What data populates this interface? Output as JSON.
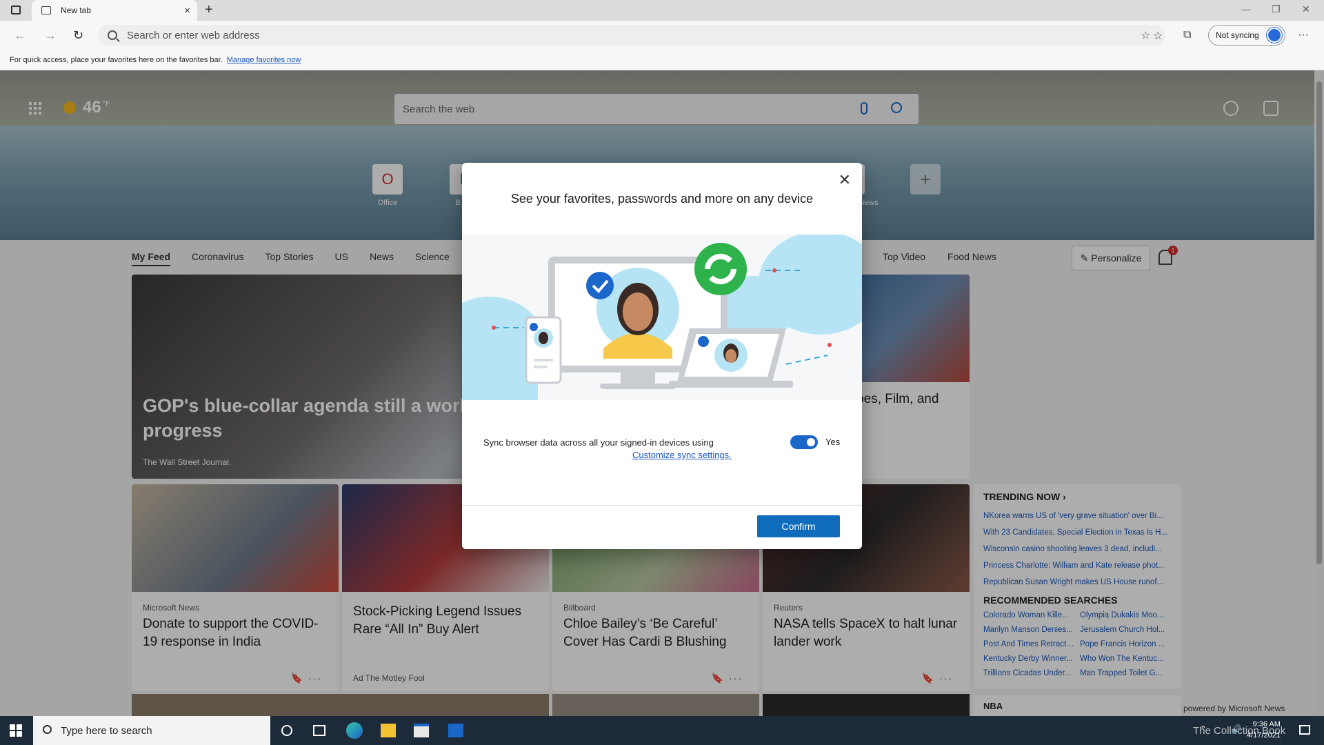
{
  "browser": {
    "tab_title": "New tab",
    "tab_close": "×",
    "new_tab": "+",
    "address_placeholder": "Search or enter web address",
    "sync_status": "Not syncing",
    "window_controls": [
      "—",
      "❐",
      "✕"
    ],
    "more_menu": "···"
  },
  "favorites_bar": {
    "message": "For quick access, place your favorites here on the favorites bar.",
    "link": "Manage favorites now"
  },
  "newtab": {
    "weather_temp": "46",
    "weather_unit": "°F",
    "search_placeholder": "Search the web",
    "tiles": [
      {
        "label": "Office",
        "glyph": "O",
        "color": "#d83b01"
      },
      {
        "label": "B",
        "glyph": "B",
        "color": "#2b7a5b"
      },
      {
        "label": "News",
        "glyph": "N",
        "color": "#555555"
      }
    ],
    "add_tile": "+",
    "feed_tabs": [
      "My Feed",
      "Coronavirus",
      "Top Stories",
      "US",
      "News",
      "Science"
    ],
    "feed_tabs_right": [
      "Top Video",
      "Food News"
    ],
    "personalize": "✎ Personalize",
    "notification_count": "1",
    "hero_headline": "GOP's blue-collar agenda still a work in progress",
    "hero_source": "The Wall Street Journal.",
    "right_card_title": "Tapes, Film, and ital",
    "cards": [
      {
        "source": "Microsoft News",
        "title": "Donate to support the COVID-19 response in India",
        "footer": "",
        "actions": "🔖 ···"
      },
      {
        "source": "",
        "title": "Stock-Picking Legend Issues Rare “All In” Buy Alert",
        "footer": "Ad  The Motley Fool",
        "actions": ""
      },
      {
        "source": "Billboard",
        "title": "Chloe Bailey’s ‘Be Careful’ Cover Has Cardi B Blushing",
        "footer": "",
        "actions": "🔖 ···"
      },
      {
        "source": "Reuters",
        "title": "NASA tells SpaceX to halt lunar lander work",
        "footer": "",
        "actions": "🔖 ···"
      }
    ],
    "trending_title": "TRENDING NOW  ›",
    "trending": [
      "NKorea warns US of 'very grave situation' over Bi...",
      "With 23 Candidates, Special Election in Texas Is H...",
      "Wisconsin casino shooting leaves 3 dead, includi...",
      "Princess Charlotte: William and Kate release phot...",
      "Republican Susan Wright makes US House runof..."
    ],
    "recommended_title": "RECOMMENDED SEARCHES",
    "recommended": [
      "Colorado Woman Kille...",
      "Olympia Dukakis Moo...",
      "Marilyn Manson Denies...",
      "Jerusalem Church Hol...",
      "Post And Times Retract ...",
      "Pope Francis Horizon ...",
      "Kentucky Derby Winner...",
      "Who Won The Kentuc...",
      "Trillions Cicadas Under...",
      "Man Trapped Toilet G..."
    ],
    "nba_label": "NBA",
    "powered_by": "powered by Microsoft News"
  },
  "modal": {
    "title": "See your favorites, passwords and more on any device",
    "sync_text": "Sync browser data across all your signed-in devices using",
    "sync_link": "Customize sync settings.",
    "toggle_on": true,
    "toggle_label": "Yes",
    "confirm": "Confirm",
    "close": "✕"
  },
  "taskbar": {
    "search_placeholder": "Type here to search",
    "time": "9:36 AM",
    "date": "4/17/2021",
    "watermark": "The Collection Book"
  },
  "colors": {
    "accent": "#0f6cbd",
    "link": "#1a57b8",
    "taskbar": "#1c2a3a"
  }
}
